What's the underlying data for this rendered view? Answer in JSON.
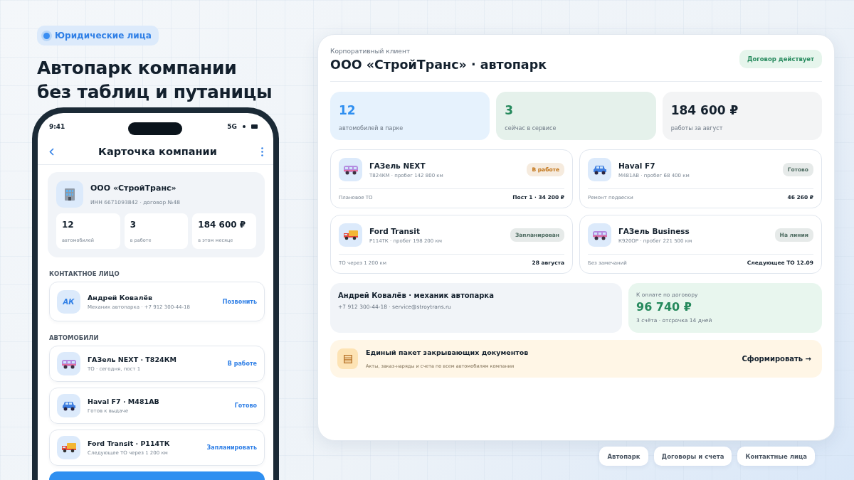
{
  "badge": {
    "label": "Юридические лица"
  },
  "headline": "Автопарк компании\nбез таблиц и путаницы",
  "phone": {
    "status_bar": {
      "time": "9:41",
      "network": "5G"
    },
    "title": "Карточка компании",
    "company": {
      "name": "ООО «СтройТранс»",
      "meta": "ИНН 6671093842 · договор №48",
      "stats": [
        {
          "value": "12",
          "label": "автомобилей"
        },
        {
          "value": "3",
          "label": "в работе"
        },
        {
          "value": "184 600 ₽",
          "label": "в этом месяце"
        }
      ]
    },
    "contact_heading": "КОНТАКТНОЕ ЛИЦО",
    "contact": {
      "initials": "АК",
      "name": "Андрей Ковалёв",
      "detail": "Механик автопарка · +7 912 300-44-18",
      "action": "Позвонить"
    },
    "cars_heading": "АВТОМОБИЛИ",
    "cars": [
      {
        "kind": "van",
        "title": "ГАЗель NEXT · Т824КМ",
        "detail": "ТО · сегодня, пост 1",
        "action": "В работе"
      },
      {
        "kind": "suv",
        "title": "Haval F7 · М481АВ",
        "detail": "Готов к выдаче",
        "action": "Готово"
      },
      {
        "kind": "truck",
        "title": "Ford Transit · Р114ТК",
        "detail": "Следующее ТО через 1 200 км",
        "action": "Запланировать"
      }
    ]
  },
  "panel": {
    "subtitle": "Корпоративный клиент",
    "title": "ООО «СтройТранс» · автопарк",
    "status": "Договор действует",
    "kpis": [
      {
        "value": "12",
        "label": "автомобилей в парке",
        "color": "#2f8ff0"
      },
      {
        "value": "3",
        "label": "сейчас в сервисе",
        "color": "#25895c"
      },
      {
        "value": "184 600 ₽",
        "label": "работы за август",
        "color": "#13202d"
      }
    ],
    "vehicles": [
      {
        "kind": "van",
        "name": "ГАЗель NEXT",
        "meta": "Т824КМ · пробег 142 800 км",
        "status": "В работе",
        "color": "#c07010",
        "note": "Плановое ТО",
        "detail": "Пост 1 · 34 200 ₽"
      },
      {
        "kind": "suv",
        "name": "Haval F7",
        "meta": "М481АВ · пробег 68 400 км",
        "status": "Готово",
        "color": "#4d6b60",
        "note": "Ремонт подвески",
        "detail": "46 260 ₽"
      },
      {
        "kind": "truck",
        "name": "Ford Transit",
        "meta": "Р114ТК · пробег 198 200 км",
        "status": "Запланирован",
        "color": "#4d6b60",
        "note": "ТО через 1 200 км",
        "detail": "28 августа"
      },
      {
        "kind": "van",
        "name": "ГАЗель Business",
        "meta": "К920ОР · пробег 221 500 км",
        "status": "На линии",
        "color": "#4d6b60",
        "note": "Без замечаний",
        "detail": "Следующее ТО 12.09"
      }
    ],
    "contact": {
      "title": "Андрей Ковалёв · механик автопарка",
      "detail": "+7 912 300-44-18 · service@stroytrans.ru"
    },
    "payment": {
      "label": "К оплате по договору",
      "amount": "96 740 ₽",
      "detail": "3 счёта · отсрочка 14 дней"
    },
    "documents": {
      "title": "Единый пакет закрывающих документов",
      "detail": "Акты, заказ-наряды и счета по всем автомобилям компании",
      "action": "Сформировать →"
    }
  },
  "nav": [
    "Автопарк",
    "Договоры и счета",
    "Контактные лица"
  ]
}
